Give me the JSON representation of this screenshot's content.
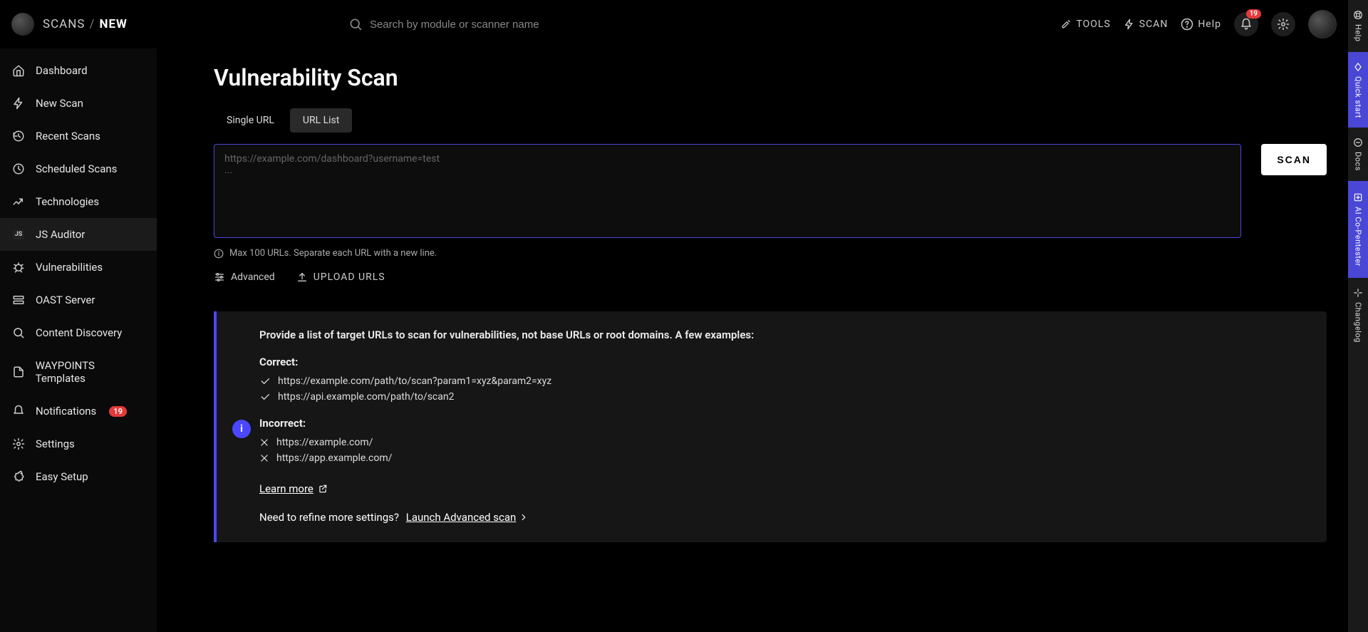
{
  "breadcrumb": {
    "part1": "SCANS",
    "sep": "/",
    "part2": "NEW"
  },
  "search": {
    "placeholder": "Search by module or scanner name"
  },
  "top": {
    "tools": "TOOLS",
    "scan": "SCAN",
    "help": "Help",
    "notif_badge": "19"
  },
  "sidebar": {
    "items": [
      {
        "label": "Dashboard"
      },
      {
        "label": "New Scan"
      },
      {
        "label": "Recent Scans"
      },
      {
        "label": "Scheduled Scans"
      },
      {
        "label": "Technologies"
      },
      {
        "label": "JS Auditor"
      },
      {
        "label": "Vulnerabilities"
      },
      {
        "label": "OAST Server"
      },
      {
        "label": "Content Discovery"
      },
      {
        "label": "WAYPOINTS Templates"
      },
      {
        "label": "Notifications",
        "badge": "19"
      },
      {
        "label": "Settings"
      },
      {
        "label": "Easy Setup"
      }
    ]
  },
  "page": {
    "title": "Vulnerability Scan",
    "tabs": {
      "single": "Single URL",
      "list": "URL List"
    },
    "url_placeholder": "https://example.com/dashboard?username=test\n...",
    "scan_btn": "SCAN",
    "hint": "Max 100 URLs. Separate each URL with a new line.",
    "advanced": "Advanced",
    "upload": "UPLOAD URLS"
  },
  "info": {
    "intro": "Provide a list of target URLs to scan for vulnerabilities, not base URLs or root domains. A few examples:",
    "correct_head": "Correct:",
    "correct": [
      "https://example.com/path/to/scan?param1=xyz&param2=xyz",
      "https://api.example.com/path/to/scan2"
    ],
    "incorrect_head": "Incorrect:",
    "incorrect": [
      "https://example.com/",
      "https://app.example.com/"
    ],
    "learn_more": "Learn more",
    "refine_q": "Need to refine more settings?",
    "launch": "Launch Advanced scan"
  },
  "rail": {
    "help": "Help",
    "quick": "Quick start",
    "docs": "Docs",
    "ai": "AI Co-Pentester",
    "changelog": "Changelog"
  }
}
